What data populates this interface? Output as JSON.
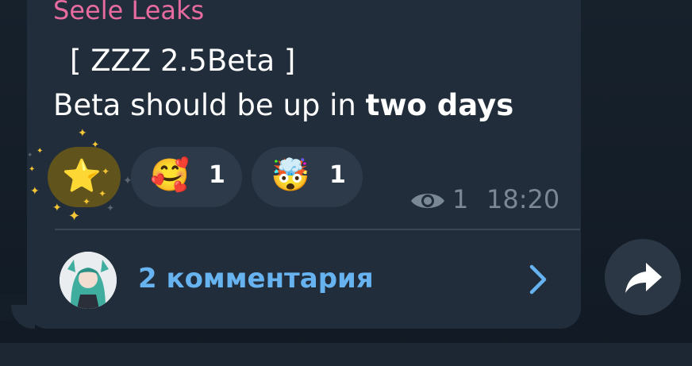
{
  "message": {
    "sender": "Seele Leaks",
    "line1": "[ ZZZ 2.5Beta ]",
    "line2_prefix": "Beta should be up in ",
    "line2_bold": "two days",
    "views": "1",
    "time": "18:20"
  },
  "reactions": [
    {
      "emoji": "⭐",
      "icon": "star-effect-icon",
      "count": ""
    },
    {
      "emoji": "🥰",
      "icon": "smiling-face-with-hearts-icon",
      "count": "1"
    },
    {
      "emoji": "🤯",
      "icon": "exploding-head-icon",
      "count": "1"
    }
  ],
  "comments": {
    "label": "2 комментария"
  },
  "colors": {
    "sender": "#e86ba0",
    "link": "#67b3f0",
    "bubble": "#212d3b"
  }
}
